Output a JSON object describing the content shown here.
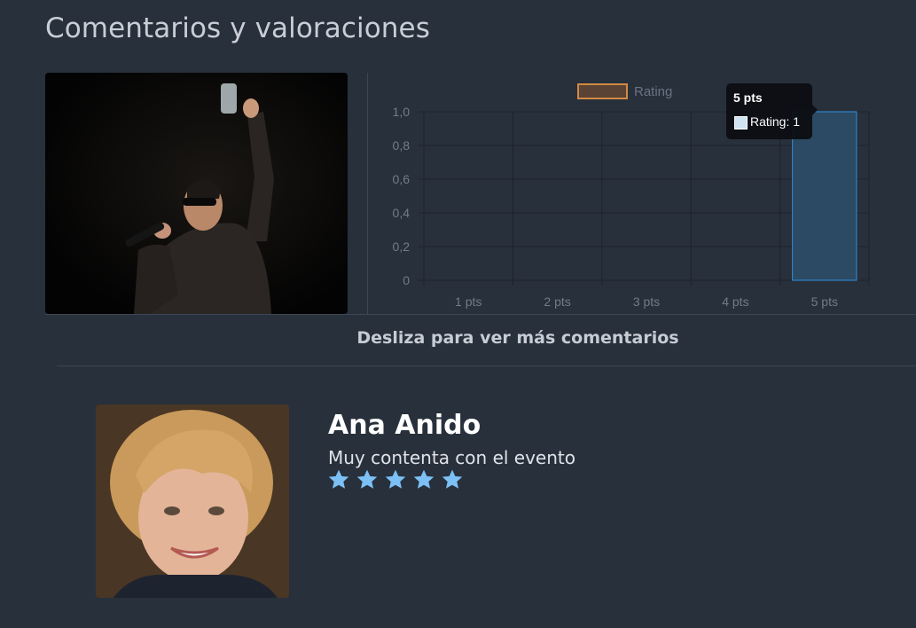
{
  "page": {
    "title": "Comentarios y valoraciones"
  },
  "chart_data": {
    "type": "bar",
    "categories": [
      "1 pts",
      "2 pts",
      "3 pts",
      "4 pts",
      "5 pts"
    ],
    "series": [
      {
        "name": "Rating",
        "values": [
          0,
          0,
          0,
          0,
          1
        ]
      }
    ],
    "ylim": [
      0,
      1
    ],
    "yticks": [
      "0",
      "0,2",
      "0,4",
      "0,6",
      "0,8",
      "1,0"
    ],
    "legend": "top",
    "grid": true,
    "tooltip": {
      "title": "5 pts",
      "body": "Rating: 1"
    },
    "colors": {
      "bar_fill": "#2c4a63",
      "bar_border": "#2f8fe0",
      "legend_fill": "#5a4235",
      "legend_border": "#d28a43"
    }
  },
  "swipe_hint": "Desliza para ver más comentarios",
  "review": {
    "name": "Ana Anido",
    "comment": "Muy contenta con el evento",
    "rating": 5,
    "star_color": "#7cc0f5"
  }
}
